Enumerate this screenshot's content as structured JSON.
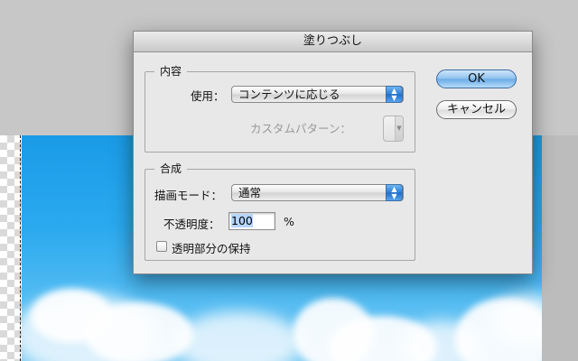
{
  "dialog": {
    "title": "塗りつぶし",
    "contents_group": {
      "title": "内容",
      "use_label": "使用：",
      "use_value": "コンテンツに応じる",
      "custom_pattern_label": "カスタムパターン："
    },
    "blending_group": {
      "title": "合成",
      "mode_label": "描画モード：",
      "mode_value": "通常",
      "opacity_label": "不透明度：",
      "opacity_value": "100",
      "opacity_unit": "%",
      "preserve_transparency_label": "透明部分の保持",
      "preserve_transparency_checked": false
    },
    "buttons": {
      "ok": "OK",
      "cancel": "キャンセル"
    }
  },
  "icons": {
    "select_arrow": "updown-arrows-icon",
    "checkbox": "checkbox-icon"
  }
}
